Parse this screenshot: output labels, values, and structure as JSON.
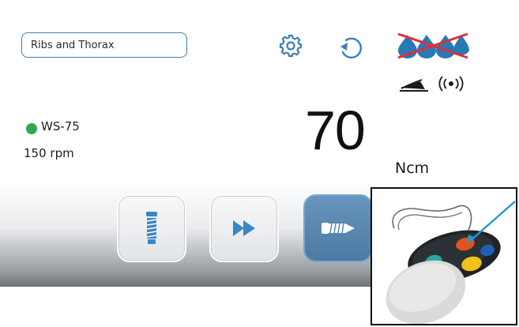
{
  "program": {
    "name": "Ribs and Thorax"
  },
  "toolbar": {
    "settings_icon": "gear-icon",
    "reset_icon": "rotate-icon",
    "coolant_icon": "coolant-drops-disabled-icon",
    "coolant_state": "off"
  },
  "status": {
    "footpedal_icon": "footpedal-icon",
    "wireless_icon": "wireless-icon"
  },
  "motor": {
    "indicator_color": "#2fa84f",
    "model": "WS-75",
    "speed": "150 rpm"
  },
  "torque": {
    "value": "70",
    "unit": "Ncm"
  },
  "modes": [
    {
      "icon": "implant-icon",
      "active": false
    },
    {
      "icon": "fast-forward-icon",
      "active": false
    },
    {
      "icon": "screw-icon",
      "active": true
    }
  ],
  "inset": {
    "icon": "wireless-foot-control-photo",
    "highlight_color": "#1f9ad6"
  },
  "colors": {
    "accent": "#3d7fb8",
    "active_mode": "#4f7ea8",
    "coolant": "#2a78b4",
    "disabled_cross": "#d9323a"
  }
}
